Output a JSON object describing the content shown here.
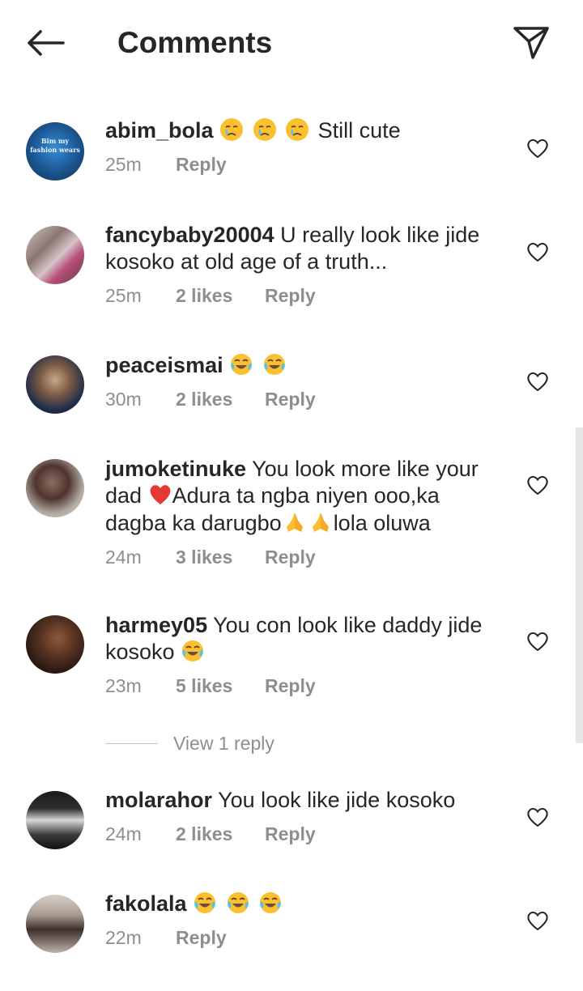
{
  "header": {
    "title": "Comments"
  },
  "comments": [
    {
      "username": "abim_bola",
      "text": "Still cute",
      "time": "25m",
      "likes": "",
      "reply": "Reply"
    },
    {
      "username": "fancybaby20004",
      "text": "U really look like jide kosoko at old age of a truth...",
      "time": "25m",
      "likes": "2 likes",
      "reply": "Reply"
    },
    {
      "username": "peaceismai",
      "text": "",
      "time": "30m",
      "likes": "2 likes",
      "reply": "Reply"
    },
    {
      "username": "jumoketinuke",
      "text_a": "You look more like your dad",
      "text_b": "Adura ta ngba niyen ooo,ka dagba ka darugbo",
      "text_c": "lola oluwa",
      "time": "24m",
      "likes": "3 likes",
      "reply": "Reply"
    },
    {
      "username": "harmey05",
      "text": "You con look like daddy jide kosoko",
      "time": "23m",
      "likes": "5 likes",
      "reply": "Reply"
    },
    {
      "username": "molarahor",
      "text": "You look like jide kosoko",
      "time": "24m",
      "likes": "2 likes",
      "reply": "Reply"
    },
    {
      "username": "fakolala",
      "text": "",
      "time": "22m",
      "likes": "",
      "reply": "Reply"
    }
  ],
  "view_replies": {
    "label": "View 1 reply"
  },
  "avatar_badges": {
    "abim_bola": "Bim my fashion wears"
  },
  "colors": {
    "text": "#262626",
    "secondary": "#8e8e8e",
    "divider": "#c7c7c7"
  }
}
